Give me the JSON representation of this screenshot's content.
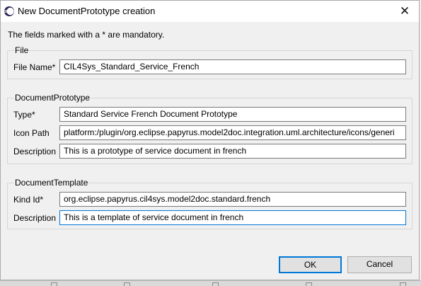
{
  "window": {
    "title": "New DocumentPrototype creation",
    "close_glyph": "✕",
    "app_icon": "eclipse-icon"
  },
  "intro_text": "The fields marked with a * are mandatory.",
  "groups": {
    "file": {
      "legend": "File",
      "file_name": {
        "label": "File Name*",
        "value": "CIL4Sys_Standard_Service_French"
      }
    },
    "document_prototype": {
      "legend": "DocumentPrototype",
      "type": {
        "label": "Type*",
        "value": "Standard Service French Document Prototype"
      },
      "icon_path": {
        "label": "Icon Path",
        "value": "platform:/plugin/org.eclipse.papyrus.model2doc.integration.uml.architecture/icons/generi"
      },
      "description": {
        "label": "Description",
        "value": "This is a prototype of service document in french"
      }
    },
    "document_template": {
      "legend": "DocumentTemplate",
      "kind_id": {
        "label": "Kind Id*",
        "value": "org.eclipse.papyrus.cil4sys.model2doc.standard.french"
      },
      "description": {
        "label": "Description",
        "value": "This is a template of service document in french"
      }
    }
  },
  "buttons": {
    "ok": "OK",
    "cancel": "Cancel"
  },
  "colors": {
    "accent": "#0078d7",
    "dialog_bg": "#f0f0f0",
    "field_bg": "#ffffff"
  }
}
